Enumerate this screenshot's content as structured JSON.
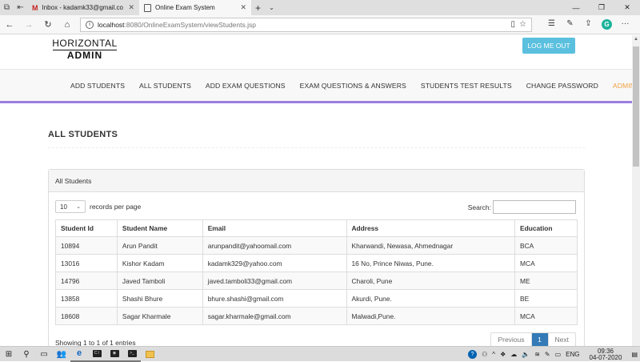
{
  "browser": {
    "tabs": [
      {
        "label": "Inbox - kadamk33@gmail.co",
        "active": false,
        "icon": "gmail-icon"
      },
      {
        "label": "Online Exam System",
        "active": true,
        "icon": "page-icon"
      }
    ],
    "url_host": "localhost",
    "url_rest": ":8080/OnlineExamSystem/viewStudents.jsp"
  },
  "header": {
    "logo_line1": "HORIZONTAL",
    "logo_line2": "ADMIN",
    "logout_label": "LOG ME OUT"
  },
  "menu": [
    {
      "label": "ADD STUDENTS",
      "active": false
    },
    {
      "label": "ALL STUDENTS",
      "active": false
    },
    {
      "label": "ADD EXAM QUESTIONS",
      "active": false
    },
    {
      "label": "EXAM QUESTIONS & ANSWERS",
      "active": false
    },
    {
      "label": "STUDENTS TEST RESULTS",
      "active": false
    },
    {
      "label": "CHANGE PASSWORD",
      "active": false
    },
    {
      "label": "ADMIN",
      "active": true
    }
  ],
  "page_title": "ALL STUDENTS",
  "panel": {
    "heading": "All Students",
    "length_value": "10",
    "length_suffix": "records per page",
    "search_label": "Search:",
    "search_value": "",
    "columns": [
      "Student Id",
      "Student Name",
      "Email",
      "Address",
      "Education"
    ],
    "rows": [
      [
        "10894",
        "Arun Pandit",
        "arunpandit@yahoomail.com",
        "Kharwandi, Newasa, Ahmednagar",
        "BCA"
      ],
      [
        "13016",
        "Kishor Kadam",
        "kadamk329@yahoo.com",
        "16 No, Prince Niwas, Pune.",
        "MCA"
      ],
      [
        "14796",
        "Javed Tamboli",
        "javed.tamboli33@gmail.com",
        "Charoli, Pune",
        "ME"
      ],
      [
        "13858",
        "Shashi Bhure",
        "bhure.shashi@gmail.com",
        "Akurdi, Pune.",
        "BE"
      ],
      [
        "18608",
        "Sagar Kharmale",
        "sagar.kharmale@gmail.com",
        "Malwadi,Pune.",
        "MCA"
      ]
    ],
    "info": "Showing 1 to 1 of 1 entries",
    "pager": {
      "prev": "Previous",
      "current": "1",
      "next": "Next"
    }
  },
  "taskbar": {
    "language": "ENG",
    "time": "09:36",
    "date": "04-07-2020"
  },
  "colors": {
    "accent_purple": "#9a7ee0",
    "logout_bg": "#5bc0de",
    "active_menu": "#f0a042",
    "pager_current": "#337ab7"
  }
}
